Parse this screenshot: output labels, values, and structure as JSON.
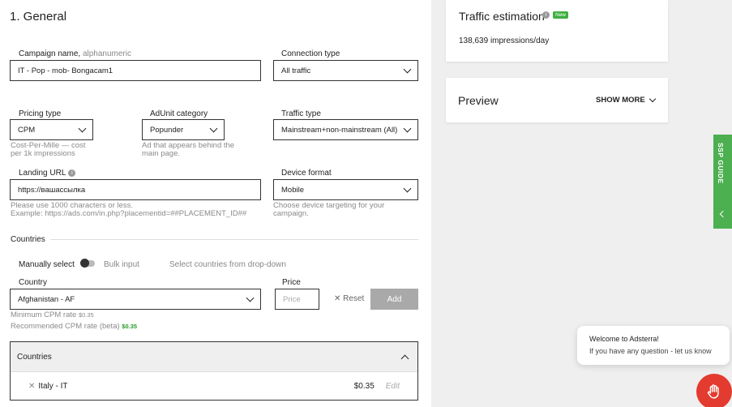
{
  "general": {
    "section_title": "1. General",
    "campaign_name": {
      "label": "Campaign name,",
      "hint": "alphanumeric",
      "value": "IT - Pop - mob- Bongacam1"
    },
    "connection_type": {
      "label": "Connection type",
      "value": "All traffic"
    },
    "pricing_type": {
      "label": "Pricing type",
      "value": "CPM",
      "help_line1": "Cost-Per-Mille — cost",
      "help_line2": "per 1k impressions"
    },
    "adunit_category": {
      "label": "AdUnit category",
      "value": "Popunder",
      "help_line1": "Ad that appears behind the",
      "help_line2": "main page."
    },
    "traffic_type": {
      "label": "Traffic type",
      "value": "Mainstream+non-mainstream (All)"
    },
    "landing_url": {
      "label": "Landing URL",
      "value": "https://вашассылка",
      "help_line1": "Please use 1000 characters or less.",
      "help_line2": "Example: https://ads.com/in.php?placementid=##PLACEMENT_ID##"
    },
    "device_format": {
      "label": "Device format",
      "value": "Mobile",
      "help_line1": "Choose device targeting for your",
      "help_line2": "campaign."
    }
  },
  "countries": {
    "heading": "Countries",
    "manual_label": "Manually select",
    "bulk_label": "Bulk input",
    "select_hint": "Select countries from drop-down",
    "country_label": "Country",
    "country_value": "Afghanistan - AF",
    "price_label": "Price",
    "price_placeholder": "Price",
    "reset_label": "Reset",
    "add_label": "Add",
    "min_rate_label": "Minimum CPM rate",
    "min_rate_value": "$0.35",
    "rec_rate_label": "Recommended CPM rate (beta)",
    "rec_rate_value": "$0.35",
    "list_title": "Countries",
    "rows": [
      {
        "name": "Italy - IT",
        "price": "$0.35",
        "edit": "Edit"
      }
    ]
  },
  "sidebar": {
    "traffic_title": "Traffic estimation",
    "new_badge": "New",
    "impressions_value": "138,639",
    "impressions_unit": "impressions/day",
    "preview_title": "Preview",
    "show_more": "SHOW MORE",
    "ssp_guide": "SSP GUIDE"
  },
  "chat": {
    "title": "Welcome to Adsterra!",
    "message": "If you have any question - let us know"
  },
  "colors": {
    "accent_green": "#4caf50",
    "badge_green": "#3dae3d",
    "chat_red": "#e33b2f",
    "button_grey": "#a9a9a9"
  }
}
